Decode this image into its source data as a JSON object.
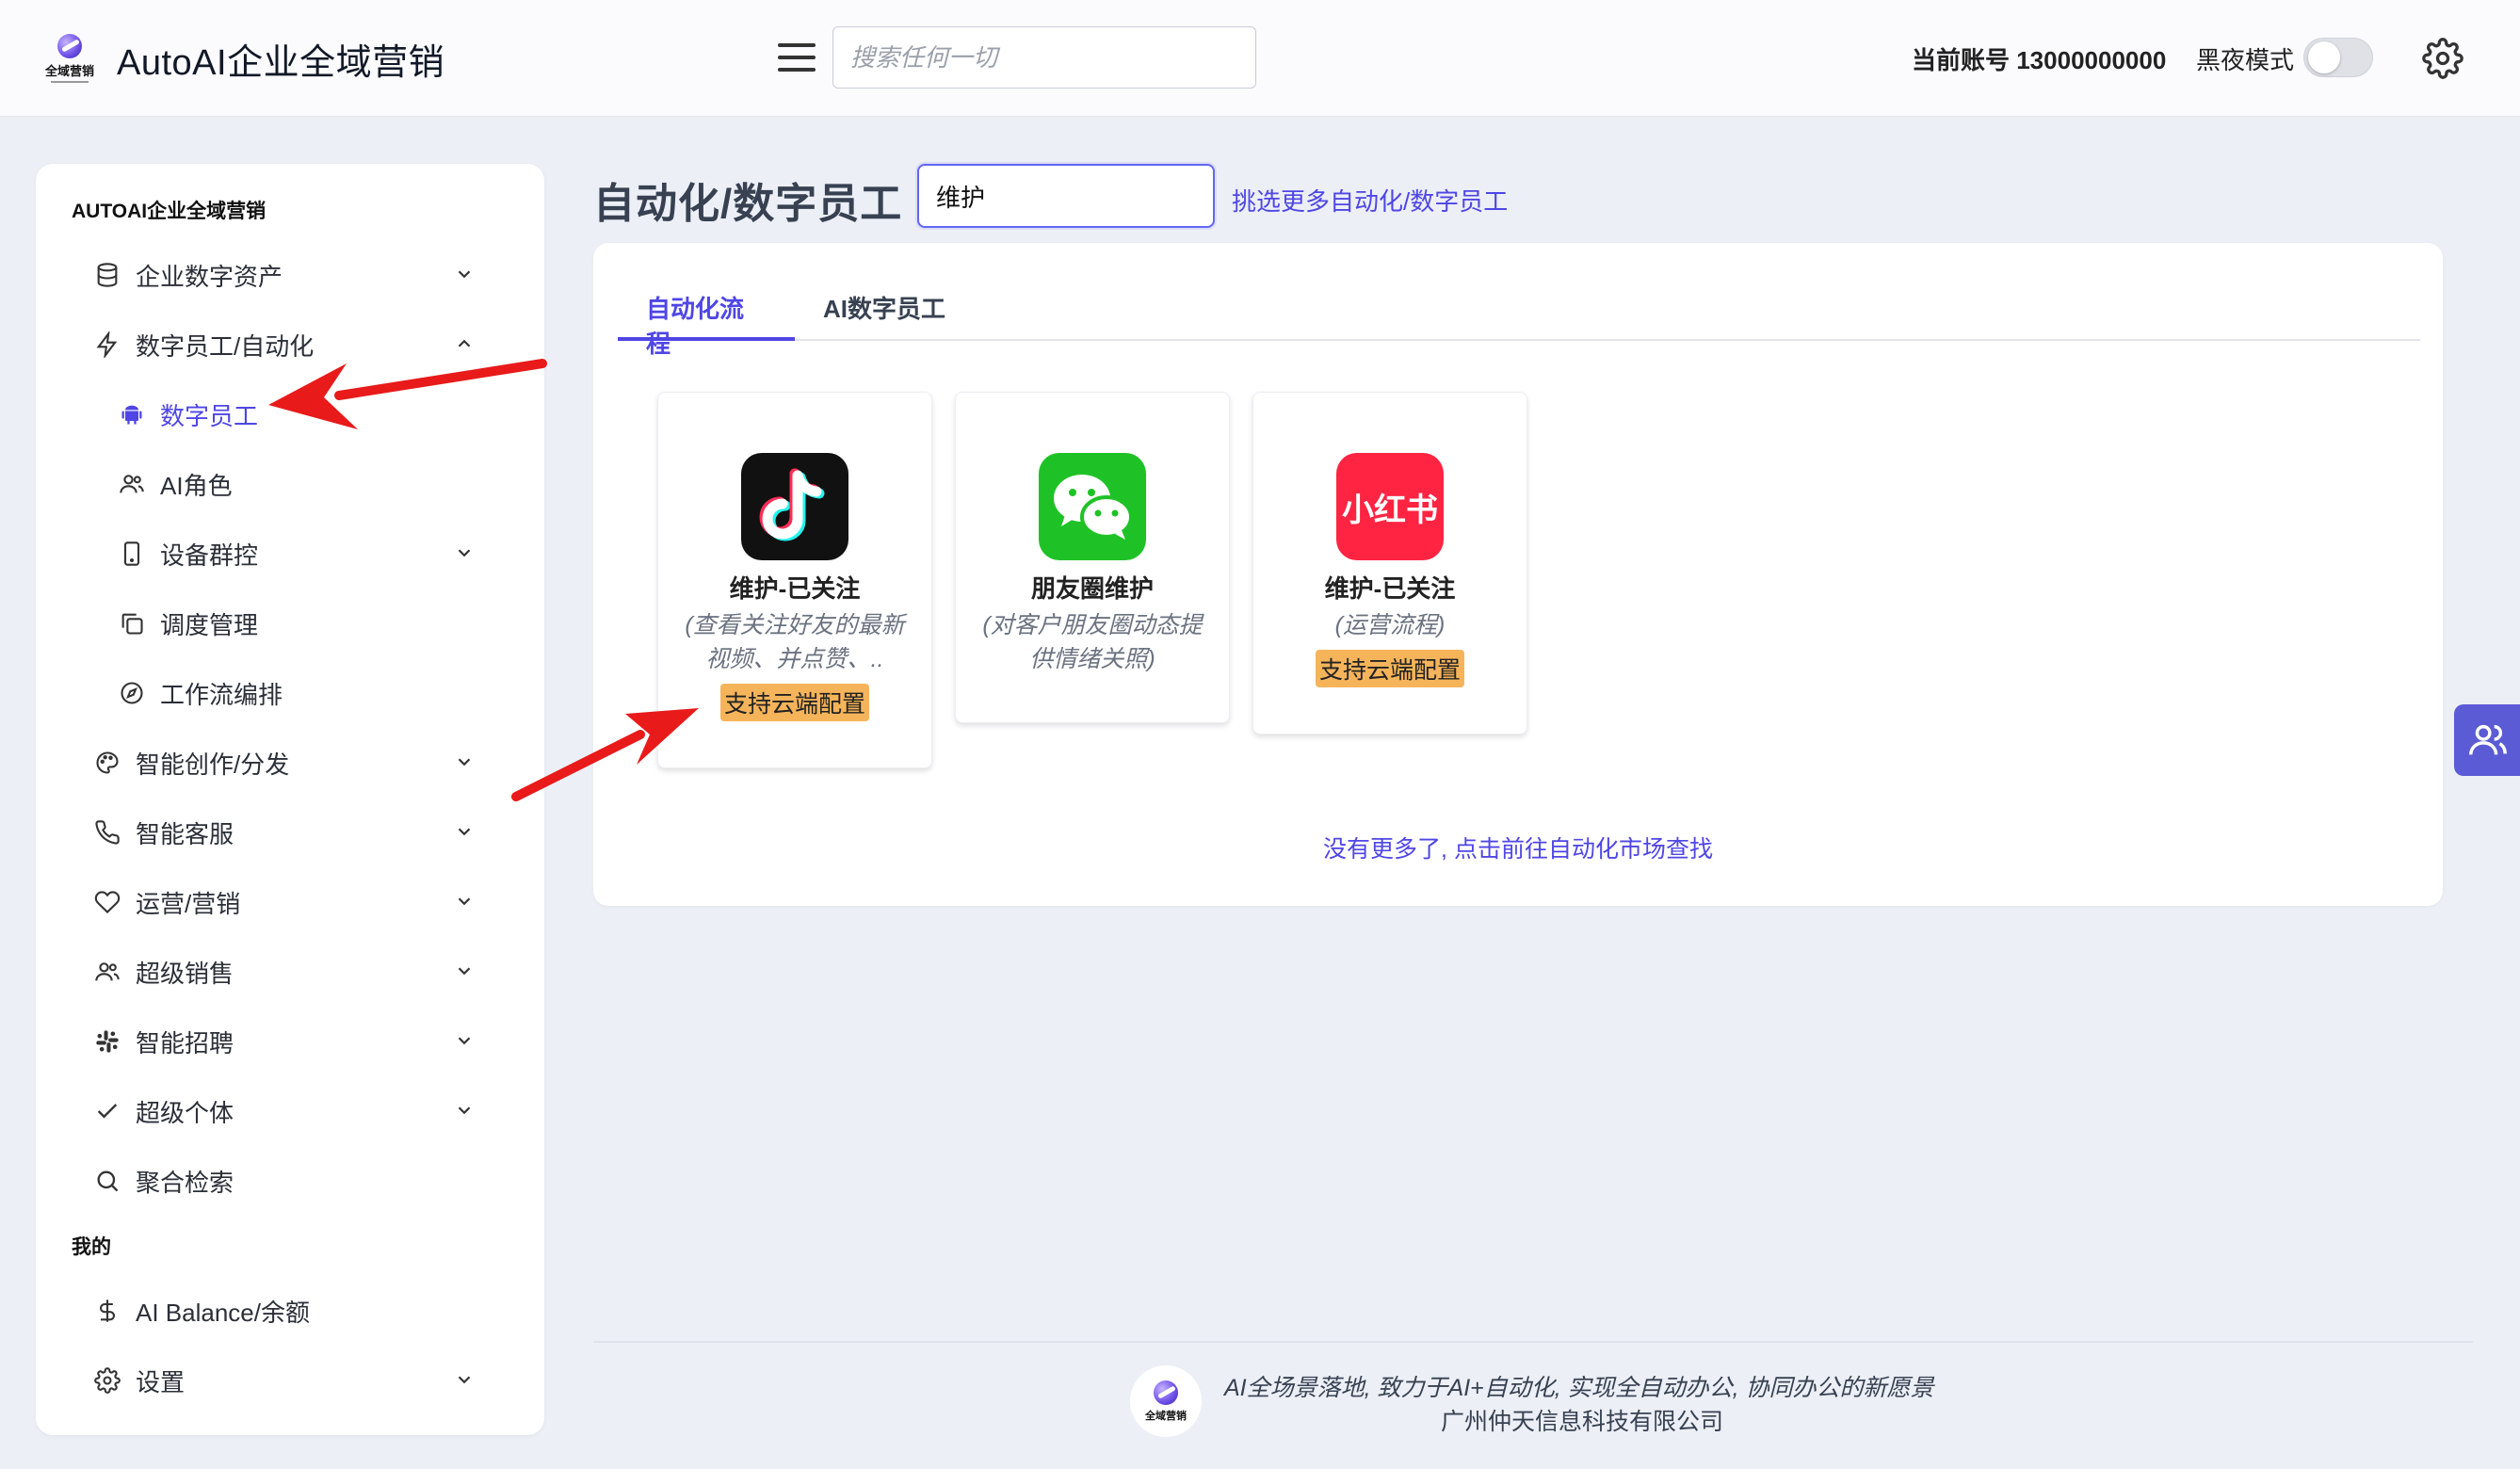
{
  "header": {
    "logo_text": "全域营销",
    "app_title": "AutoAI企业全域营销",
    "search_placeholder": "搜索任何一切",
    "account_label": "当前账号 13000000000",
    "night_mode_label": "黑夜模式",
    "night_mode_on": false
  },
  "sidebar": {
    "section_main": "AUTOAI企业全域营销",
    "items": [
      {
        "label": "企业数字资产",
        "icon": "database-icon",
        "expandable": true
      },
      {
        "label": "数字员工/自动化",
        "icon": "bolt-icon",
        "expandable": true,
        "expanded": true
      },
      {
        "label": "数字员工",
        "icon": "android-icon",
        "active": true
      },
      {
        "label": "AI角色",
        "icon": "users-icon"
      },
      {
        "label": "设备群控",
        "icon": "phone-icon",
        "expandable": true
      },
      {
        "label": "调度管理",
        "icon": "copy-icon"
      },
      {
        "label": "工作流编排",
        "icon": "compass-icon"
      },
      {
        "label": "智能创作/分发",
        "icon": "palette-icon",
        "expandable": true
      },
      {
        "label": "智能客服",
        "icon": "phone-call-icon",
        "expandable": true
      },
      {
        "label": "运营/营销",
        "icon": "heart-icon",
        "expandable": true
      },
      {
        "label": "超级销售",
        "icon": "users-icon",
        "expandable": true
      },
      {
        "label": "智能招聘",
        "icon": "slack-icon",
        "expandable": true
      },
      {
        "label": "超级个体",
        "icon": "check-icon",
        "expandable": true
      },
      {
        "label": "聚合检索",
        "icon": "search-icon"
      }
    ],
    "section_mine": "我的",
    "mine_items": [
      {
        "label": "AI Balance/余额",
        "icon": "dollar-icon"
      },
      {
        "label": "设置",
        "icon": "gear-icon",
        "expandable": true
      }
    ]
  },
  "main": {
    "page_title": "自动化/数字员工",
    "filter_value": "维护",
    "more_link": "挑选更多自动化/数字员工",
    "tabs": [
      {
        "label": "自动化流程",
        "active": true
      },
      {
        "label": "AI数字员工",
        "active": false
      }
    ],
    "cards": [
      {
        "title": "维护-已关注",
        "desc": "(查看关注好友的最新视频、并点赞、..",
        "badge": "支持云端配置",
        "icon": "tiktok-icon"
      },
      {
        "title": "朋友圈维护",
        "desc": "(对客户朋友圈动态提供情绪关照)",
        "badge": "",
        "icon": "wechat-icon"
      },
      {
        "title": "维护-已关注",
        "desc": "(运营流程)",
        "badge": "支持云端配置",
        "icon": "xiaohongshu-icon",
        "icon_text": "小红书"
      }
    ],
    "no_more": "没有更多了, 点击前往自动化市场查找"
  },
  "footer": {
    "slogan": "AI全场景落地, 致力于AI+自动化, 实现全自动办公, 协同办公的新愿景",
    "company": "广州仲天信息科技有限公司"
  },
  "colors": {
    "accent": "#4f46e5",
    "badge": "#f6b45a",
    "annotation_arrow": "#e81a1a"
  }
}
